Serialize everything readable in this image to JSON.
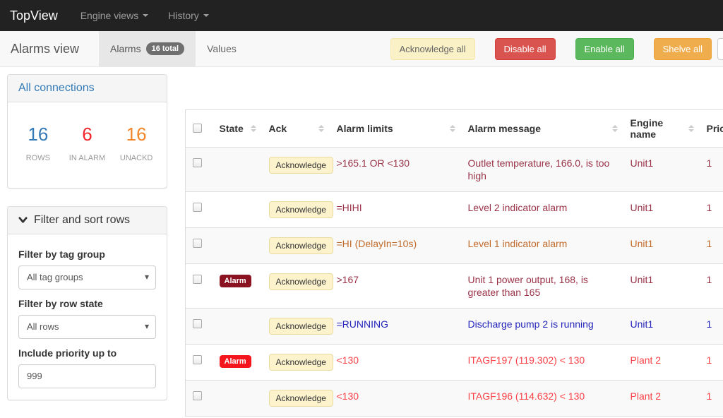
{
  "navbar": {
    "brand": "TopView",
    "menus": [
      {
        "label": "Engine views"
      },
      {
        "label": "History"
      }
    ]
  },
  "toolbar": {
    "title": "Alarms view",
    "tabs": [
      {
        "label": "Alarms",
        "badge": "16 total",
        "active": true
      },
      {
        "label": "Values",
        "active": false
      }
    ],
    "buttons": [
      {
        "label": "Acknowledge all"
      },
      {
        "label": "Disable all"
      },
      {
        "label": "Enable all"
      },
      {
        "label": "Shelve all"
      }
    ]
  },
  "sidebar": {
    "connections": {
      "title": "All connections",
      "stats": [
        {
          "value": "16",
          "label": "ROWS",
          "color": "#337ab7"
        },
        {
          "value": "6",
          "label": "IN ALARM",
          "color": "#f2242c"
        },
        {
          "value": "16",
          "label": "UNACKD",
          "color": "#f2862a"
        }
      ]
    },
    "filter": {
      "title": "Filter and sort rows",
      "fields": [
        {
          "label": "Filter by tag group",
          "type": "select",
          "value": "All tag groups"
        },
        {
          "label": "Filter by row state",
          "type": "select",
          "value": "All rows"
        },
        {
          "label": "Include priority up to",
          "type": "input",
          "value": "999"
        }
      ]
    }
  },
  "table": {
    "columns": [
      "State",
      "Ack",
      "Alarm limits",
      "Alarm message",
      "Engine name",
      "Priority"
    ],
    "ack_label": "Acknowledge",
    "alarm_badge_label": "Alarm",
    "rows": [
      {
        "state": "",
        "limits": ">165.1 OR <130",
        "message": "Outlet temperature, 166.0, is too high",
        "engine": "Unit1",
        "priority": "1",
        "severity": "maroon"
      },
      {
        "state": "",
        "limits": "=HIHI",
        "message": "Level 2 indicator alarm",
        "engine": "Unit1",
        "priority": "1",
        "severity": "maroon"
      },
      {
        "state": "",
        "limits": "=HI (DelayIn=10s)",
        "message": "Level 1 indicator alarm",
        "engine": "Unit1",
        "priority": "1",
        "severity": "orange"
      },
      {
        "state": "Alarm",
        "limits": ">167",
        "message": "Unit 1 power output, 168, is greater than 165",
        "engine": "Unit1",
        "priority": "1",
        "severity": "maroon"
      },
      {
        "state": "",
        "limits": "=RUNNING",
        "message": "Discharge pump 2 is running",
        "engine": "Unit1",
        "priority": "1",
        "severity": "blue"
      },
      {
        "state": "Alarm",
        "limits": "<130",
        "message": "ITAGF197 (119.302) < 130",
        "engine": "Plant 2",
        "priority": "1",
        "severity": "red"
      },
      {
        "state": "",
        "limits": "<130",
        "message": "ITAGF196 (114.632) < 130",
        "engine": "Plant 2",
        "priority": "1",
        "severity": "red"
      }
    ]
  },
  "colors": {
    "navbar_bg": "#222222",
    "severity_maroon": "#9a3247",
    "severity_orange": "#c06a2a",
    "severity_blue": "#2424bb",
    "severity_red": "#fb4146",
    "badge_dark_red": "#8b1220",
    "badge_bright_red": "#f5161d",
    "button_yellow": "#faf1c6",
    "button_red": "#d9534f",
    "button_green": "#5cb85c",
    "button_orange": "#f0ad4e"
  }
}
